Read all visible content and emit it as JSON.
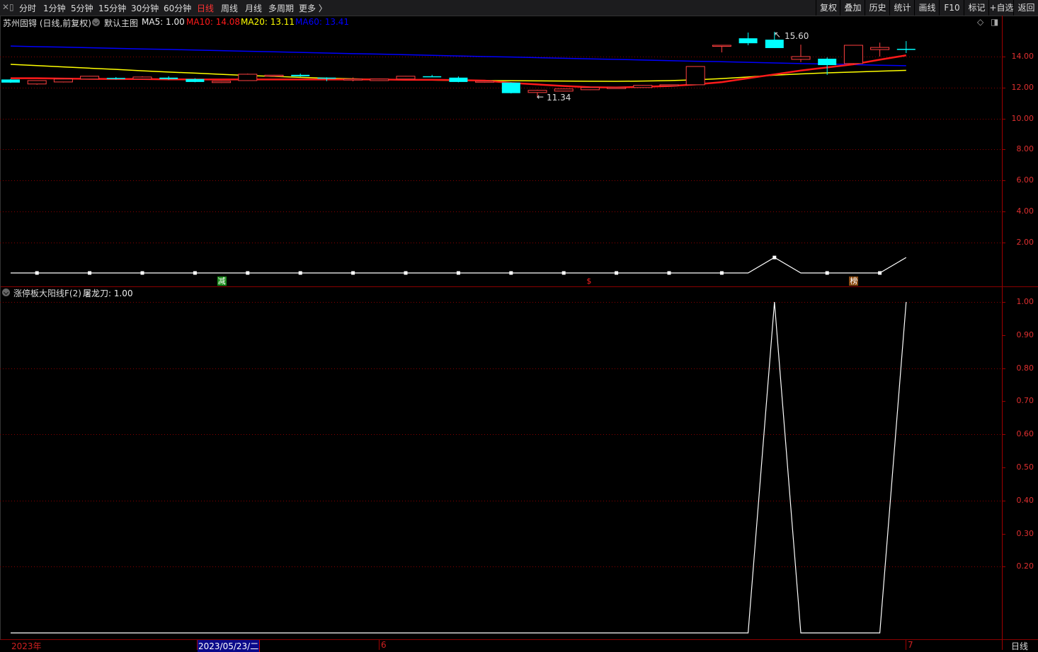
{
  "toolbar": {
    "left_tabs": [
      "分时",
      "1分钟",
      "5分钟",
      "15分钟",
      "30分钟",
      "60分钟",
      "日线",
      "周线",
      "月线",
      "多周期",
      "更多 〉"
    ],
    "active_tab": "日线",
    "right_buttons": [
      "复权",
      "叠加",
      "历史",
      "统计",
      "画线",
      "F10",
      "标记",
      "+自选",
      "返回"
    ]
  },
  "main_chart": {
    "title": "苏州固锝 (日线,前复权)",
    "template": "默认主图",
    "ma5": "MA5: 1.00",
    "ma10": "MA10: 14.08",
    "ma20": "MA20: 13.11",
    "ma60": "MA60: 13.41",
    "high_label": "15.60",
    "low_label": "11.34",
    "price_axis": [
      "14.00",
      "12.00",
      "10.00",
      "8.00",
      "6.00",
      "4.00",
      "2.00"
    ],
    "price_axis_values": [
      14,
      12,
      10,
      8,
      6,
      4,
      2
    ],
    "signals": [
      {
        "text": "减",
        "index": 8,
        "color": "#1a8a1a"
      },
      {
        "text": "$",
        "index": 22,
        "color": "#ff2020"
      },
      {
        "text": "榜",
        "index": 32,
        "color": "#8a4a10"
      }
    ],
    "colors": {
      "up": "#ff4040",
      "down": "#00ffff",
      "ma10": "#ff1a1a",
      "ma20": "#ffff00",
      "ma60": "#0000ff",
      "grid": "#8b0000"
    }
  },
  "chart_data": {
    "type": "candlestick",
    "candles": [
      [
        12.52,
        12.32,
        12.55,
        12.3
      ],
      [
        12.23,
        12.45,
        12.46,
        12.18
      ],
      [
        12.36,
        12.55,
        12.57,
        12.33
      ],
      [
        12.55,
        12.73,
        12.75,
        12.52
      ],
      [
        12.62,
        12.55,
        12.68,
        12.52
      ],
      [
        12.55,
        12.68,
        12.73,
        12.52
      ],
      [
        12.64,
        12.55,
        12.73,
        12.5
      ],
      [
        12.55,
        12.36,
        12.6,
        12.34
      ],
      [
        12.32,
        12.41,
        12.43,
        12.3
      ],
      [
        12.45,
        12.86,
        12.9,
        12.43
      ],
      [
        12.73,
        12.8,
        12.82,
        12.7
      ],
      [
        12.82,
        12.73,
        12.9,
        12.7
      ],
      [
        12.64,
        12.62,
        12.66,
        12.41
      ],
      [
        12.55,
        12.55,
        12.65,
        12.4
      ],
      [
        12.45,
        12.55,
        12.57,
        12.43
      ],
      [
        12.55,
        12.73,
        12.75,
        12.53
      ],
      [
        12.73,
        12.7,
        12.82,
        12.68
      ],
      [
        12.64,
        12.36,
        12.72,
        12.34
      ],
      [
        12.36,
        12.41,
        12.43,
        12.32
      ],
      [
        12.32,
        11.64,
        12.34,
        11.62
      ],
      [
        11.68,
        11.82,
        11.86,
        11.34
      ],
      [
        11.77,
        11.91,
        11.93,
        11.75
      ],
      [
        11.86,
        12.0,
        12.02,
        11.84
      ],
      [
        11.98,
        12.0,
        12.02,
        11.96
      ],
      [
        12.0,
        12.14,
        12.16,
        11.98
      ],
      [
        12.16,
        12.18,
        12.2,
        12.14
      ],
      [
        12.18,
        13.36,
        13.38,
        12.16
      ],
      [
        14.72,
        14.73,
        14.75,
        14.27
      ],
      [
        15.18,
        14.86,
        15.55,
        14.73
      ],
      [
        15.09,
        14.55,
        15.6,
        14.55
      ],
      [
        13.82,
        14.0,
        14.77,
        13.64
      ],
      [
        13.86,
        13.45,
        13.95,
        12.82
      ],
      [
        13.55,
        14.73,
        14.73,
        13.5
      ],
      [
        14.45,
        14.59,
        14.9,
        14.0
      ],
      [
        14.5,
        14.45,
        15.0,
        14.23
      ]
    ],
    "ma10": [
      12.6,
      12.6,
      12.58,
      12.56,
      12.55,
      12.55,
      12.53,
      12.52,
      12.52,
      12.52,
      12.52,
      12.52,
      12.52,
      12.52,
      12.52,
      12.5,
      12.5,
      12.48,
      12.45,
      12.3,
      12.2,
      12.1,
      12.02,
      12.0,
      12.05,
      12.1,
      12.2,
      12.35,
      12.6,
      12.85,
      13.1,
      13.3,
      13.5,
      13.8,
      14.08
    ],
    "ma20": [
      13.5,
      13.42,
      13.33,
      13.25,
      13.17,
      13.08,
      13.0,
      12.93,
      12.85,
      12.78,
      12.72,
      12.66,
      12.6,
      12.56,
      12.52,
      12.5,
      12.48,
      12.46,
      12.45,
      12.44,
      12.43,
      12.42,
      12.41,
      12.4,
      12.42,
      12.45,
      12.5,
      12.58,
      12.68,
      12.8,
      12.88,
      12.95,
      13.0,
      13.06,
      13.11
    ],
    "ma60": [
      14.68,
      14.64,
      14.61,
      14.57,
      14.53,
      14.49,
      14.46,
      14.42,
      14.38,
      14.34,
      14.31,
      14.27,
      14.23,
      14.19,
      14.16,
      14.12,
      14.08,
      14.04,
      14.0,
      13.97,
      13.93,
      13.89,
      13.85,
      13.82,
      13.78,
      13.74,
      13.7,
      13.67,
      13.63,
      13.59,
      13.55,
      13.52,
      13.48,
      13.44,
      13.41
    ],
    "indicator": [
      0,
      0,
      0,
      0,
      0,
      0,
      0,
      0,
      0,
      0,
      0,
      0,
      0,
      0,
      0,
      0,
      0,
      0,
      0,
      0,
      0,
      0,
      0,
      0,
      0,
      0,
      0,
      0,
      0,
      1,
      0,
      0,
      0,
      0,
      1
    ],
    "indicator_axis": [
      "1.00",
      "0.90",
      "0.80",
      "0.70",
      "0.60",
      "0.50",
      "0.40",
      "0.30",
      "0.20"
    ],
    "indicator_axis_values": [
      1.0,
      0.9,
      0.8,
      0.7,
      0.6,
      0.5,
      0.4,
      0.3,
      0.2
    ]
  },
  "sub_chart": {
    "title": "涨停板大阳线F(2)",
    "value": "屠龙刀: 1.00"
  },
  "x_axis": {
    "year": "2023年",
    "cursor_date": "2023/05/23/二",
    "month6": "6",
    "month7": "7",
    "period": "日线"
  }
}
